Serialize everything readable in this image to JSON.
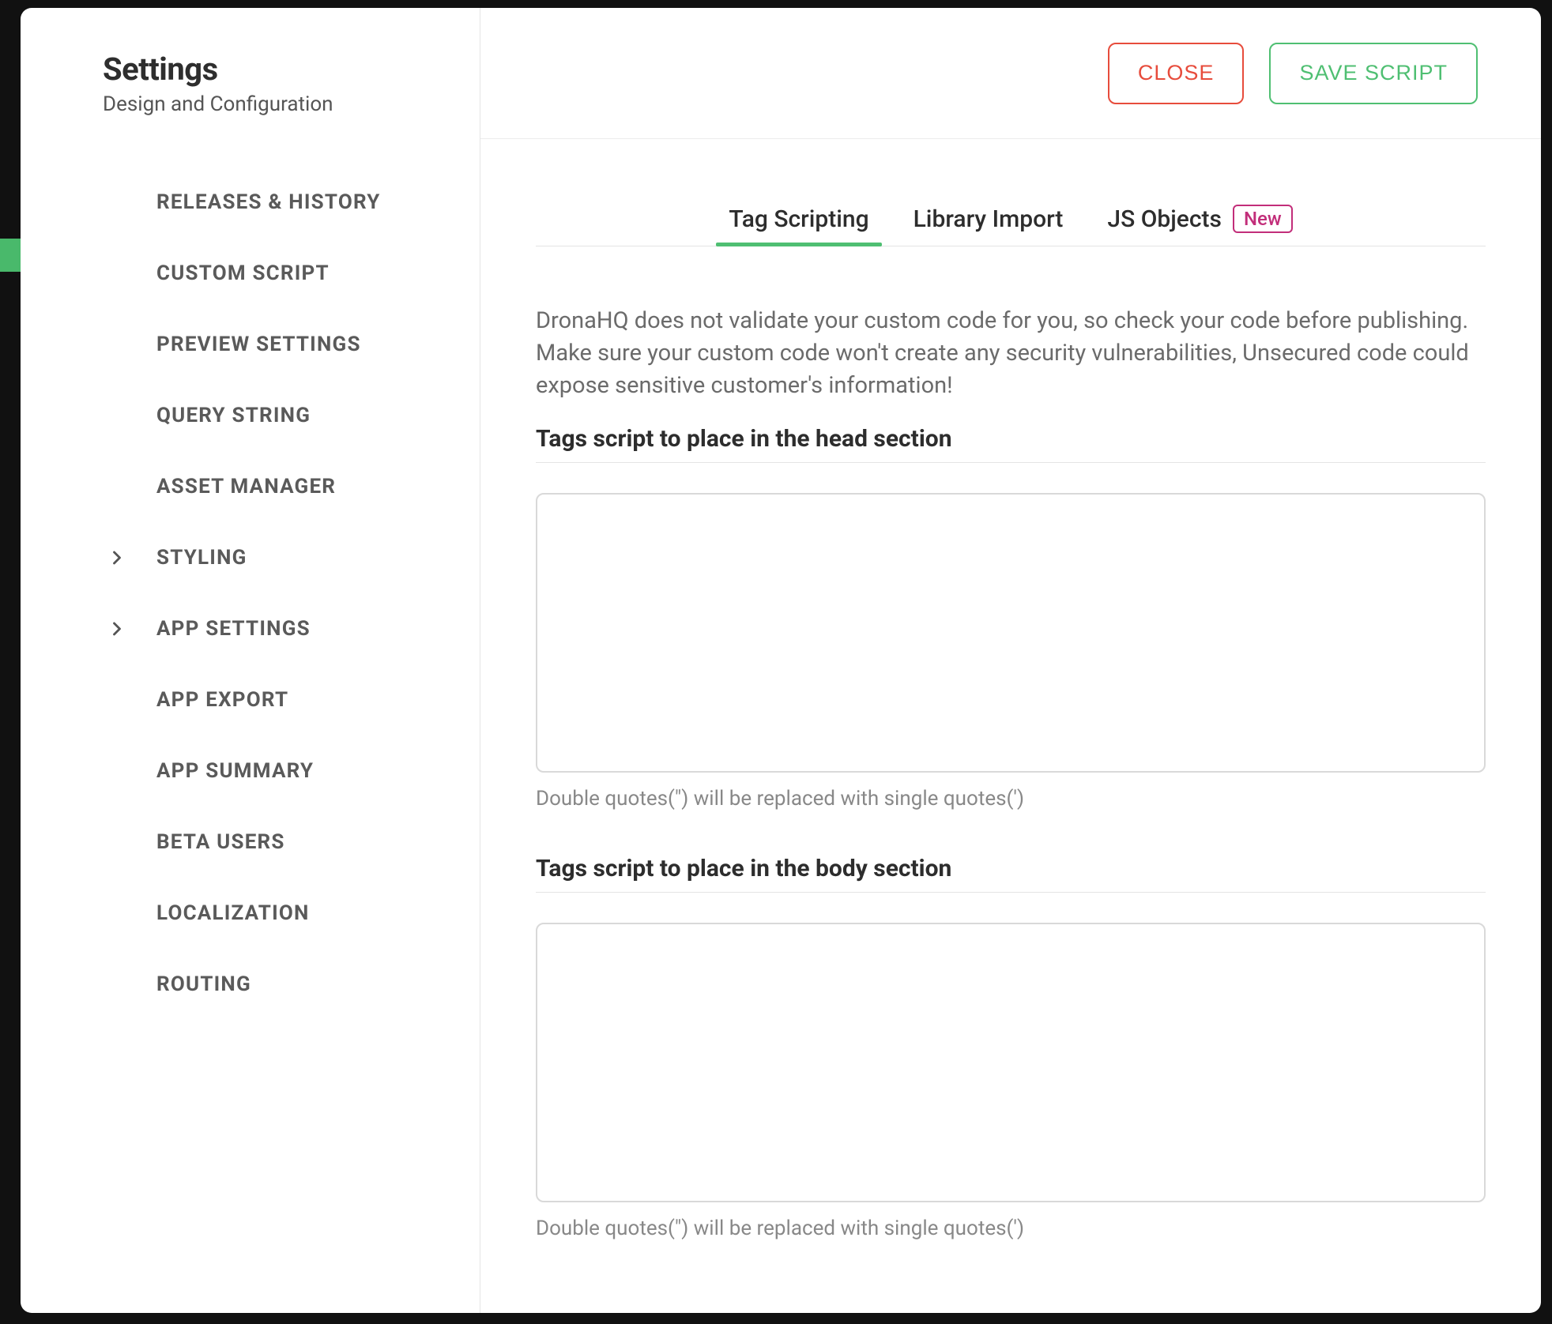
{
  "sidebar": {
    "title": "Settings",
    "subtitle": "Design and Configuration",
    "items": [
      {
        "label": "RELEASES & HISTORY",
        "expandable": false
      },
      {
        "label": "CUSTOM SCRIPT",
        "expandable": false
      },
      {
        "label": "PREVIEW SETTINGS",
        "expandable": false
      },
      {
        "label": "QUERY STRING",
        "expandable": false
      },
      {
        "label": "ASSET MANAGER",
        "expandable": false
      },
      {
        "label": "STYLING",
        "expandable": true
      },
      {
        "label": "APP SETTINGS",
        "expandable": true
      },
      {
        "label": "APP EXPORT",
        "expandable": false
      },
      {
        "label": "APP SUMMARY",
        "expandable": false
      },
      {
        "label": "BETA USERS",
        "expandable": false
      },
      {
        "label": "LOCALIZATION",
        "expandable": false
      },
      {
        "label": "ROUTING",
        "expandable": false
      }
    ]
  },
  "topbar": {
    "close_label": "CLOSE",
    "save_label": "SAVE SCRIPT"
  },
  "tabs": [
    {
      "label": "Tag Scripting",
      "active": true,
      "badge": null
    },
    {
      "label": "Library Import",
      "active": false,
      "badge": null
    },
    {
      "label": "JS Objects",
      "active": false,
      "badge": "New"
    }
  ],
  "warning_text": "DronaHQ does not validate your custom code for you, so check your code before publishing. Make sure your custom code won't create any security vulnerabilities, Unsecured code could expose sensitive customer's information!",
  "head_section": {
    "title": "Tags script to place in the head section",
    "value": "",
    "hint": "Double quotes(\") will be replaced with single quotes(')"
  },
  "body_section": {
    "title": "Tags script to place in the body section",
    "value": "",
    "hint": "Double quotes(\") will be replaced with single quotes(')"
  }
}
